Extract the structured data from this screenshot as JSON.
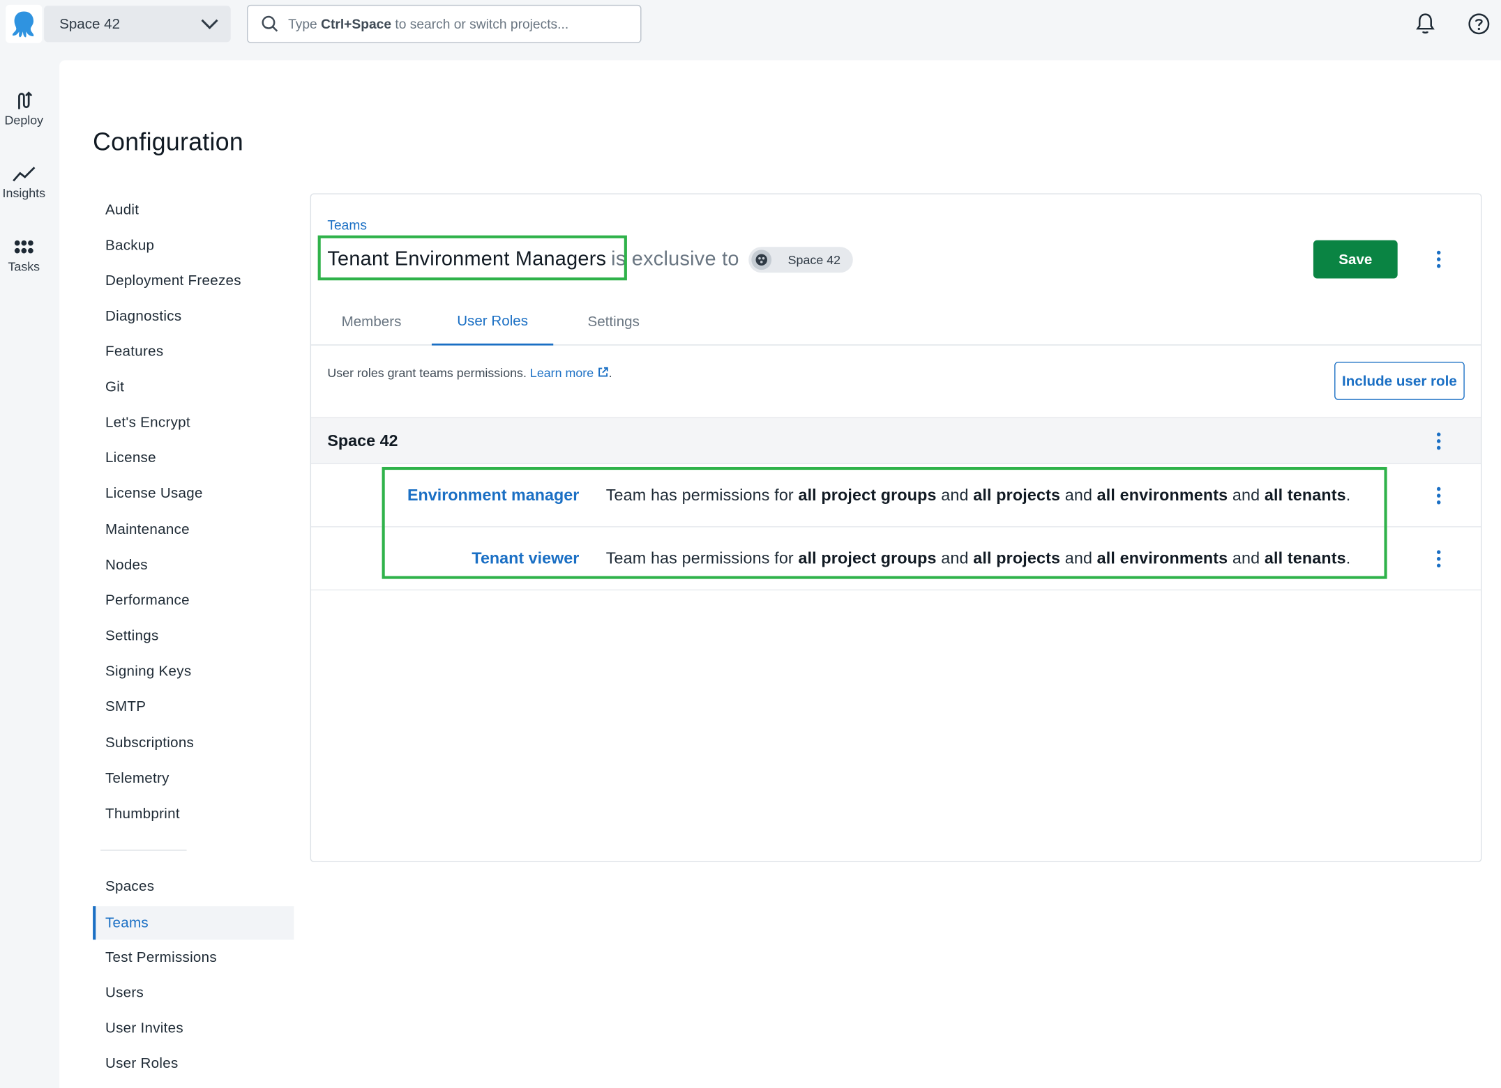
{
  "topbar": {
    "space_name": "Space 42",
    "search": {
      "prefix": "Type ",
      "shortcut": "Ctrl+Space",
      "suffix": " to search or switch projects..."
    },
    "icons": [
      "octopus-logo-icon",
      "chevron-down-icon",
      "search-icon",
      "bell-icon",
      "help-icon"
    ]
  },
  "rail": [
    {
      "label": "Deploy",
      "icon": "deploy-icon"
    },
    {
      "label": "Insights",
      "icon": "insights-icon"
    },
    {
      "label": "Tasks",
      "icon": "tasks-icon"
    }
  ],
  "page": {
    "title": "Configuration"
  },
  "nav": {
    "items": [
      "Audit",
      "Backup",
      "Deployment Freezes",
      "Diagnostics",
      "Features",
      "Git",
      "Let's Encrypt",
      "License",
      "License Usage",
      "Maintenance",
      "Nodes",
      "Performance",
      "Settings",
      "Signing Keys",
      "SMTP",
      "Subscriptions",
      "Telemetry",
      "Thumbprint"
    ],
    "items2": [
      "Spaces",
      "Teams",
      "Test Permissions",
      "Users",
      "User Invites",
      "User Roles"
    ],
    "active": "Teams"
  },
  "team": {
    "breadcrumb": "Teams",
    "name": "Tenant Environment Managers",
    "exclusive_text": "is exclusive to",
    "space_chip": "Space 42",
    "save_label": "Save"
  },
  "tabs": [
    {
      "label": "Members",
      "active": false
    },
    {
      "label": "User Roles",
      "active": true
    },
    {
      "label": "Settings",
      "active": false
    }
  ],
  "user_roles": {
    "hint": "User roles grant teams permissions.",
    "learn_more": "Learn more",
    "hint_end": ".",
    "include_label": "Include user role",
    "group": "Space 42",
    "desc_parts": [
      "Team has permissions for ",
      "all project groups",
      " and ",
      "all projects",
      " and ",
      "all environments",
      " and ",
      "all tenants",
      "."
    ],
    "roles": [
      {
        "name": "Environment manager"
      },
      {
        "name": "Tenant viewer"
      }
    ]
  },
  "colors": {
    "accent": "#1a6fc4",
    "save": "#0a8443",
    "highlight": "#2fb24a"
  }
}
